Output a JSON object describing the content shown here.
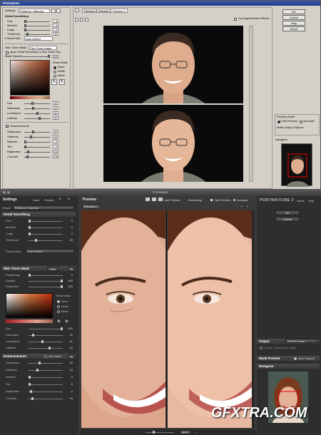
{
  "top": {
    "title": "Portraiture",
    "settings_label": "Settings",
    "settings_value": "Enhance: Glamour",
    "detail_header": "Detail Smoothing",
    "detail_controls": [
      {
        "label": "Fine",
        "value": "0"
      },
      {
        "label": "Medium",
        "value": "0"
      },
      {
        "label": "Large",
        "value": "0"
      },
      {
        "label": "Threshold",
        "value": "10"
      }
    ],
    "portrait_size_label": "Portrait Size",
    "portrait_size_value": "Auto Detect",
    "skin_mask_label": "Skin Tones Mask",
    "skin_mask_value": "Pick From Image",
    "apply_label": "Apply \"Detail Smoothing\" to Skin Tones Only",
    "mask_opacity_label": "Mask Opacity",
    "mask_opacity_value": "100",
    "show_mask_label": "Show Mask",
    "show_mask_options": [
      "None",
      "White",
      "Black"
    ],
    "mask_controls": [
      {
        "label": "Hue",
        "value": "30"
      },
      {
        "label": "Saturation",
        "value": "33"
      },
      {
        "label": "Luminance",
        "value": "50"
      },
      {
        "label": "Latitude",
        "value": "60"
      }
    ],
    "enhancements_label": "Enhancements",
    "enh_controls": [
      {
        "label": "Sharpness",
        "value": "32"
      },
      {
        "label": "Softness",
        "value": "24"
      },
      {
        "label": "Warmth",
        "value": "0"
      },
      {
        "label": "Tint",
        "value": "0"
      },
      {
        "label": "Brightness",
        "value": "+12"
      },
      {
        "label": "Contrast",
        "value": "+10"
      }
    ],
    "tabs": [
      "Preview 1",
      "Preview 2",
      "Preview 3"
    ],
    "top_bottom_label": "Top Original Bottom Filtered",
    "buttons": [
      "OK",
      "Cancel",
      "Help",
      "About"
    ],
    "preview_mode_label": "Preview Mode",
    "fast_preview": "Fast Preview",
    "accurate": "Accurate",
    "mask_output_label": "Mask Output Options",
    "navigator_label": "Navigator"
  },
  "bot": {
    "title": "Portraiture",
    "settings_label": "Settings",
    "save_label": "Save",
    "presets_label": "Presets",
    "preset_label": "Preset",
    "preset_value": "Enhance: Glamour",
    "detail_header": "Detail Smoothing",
    "detail_controls": [
      {
        "label": "Fine",
        "value": "0"
      },
      {
        "label": "Medium",
        "value": "0"
      },
      {
        "label": "Large",
        "value": "0"
      },
      {
        "label": "Threshold",
        "value": "20"
      }
    ],
    "portrait_size_label": "Portrait Size",
    "portrait_size_value": "Auto Detect",
    "skin_header": "Skin Tones Mask",
    "skin_mode": "Auto",
    "skin_controls_top": [
      {
        "label": "Feathering",
        "value": "0"
      },
      {
        "label": "Opacity",
        "value": "100"
      },
      {
        "label": "Fuzziness",
        "value": "100"
      }
    ],
    "show_mask_label": "Show Mask",
    "show_mask_options": [
      "None",
      "White",
      "Black"
    ],
    "skin_controls_bottom": [
      {
        "label": "Hue",
        "value": "100"
      },
      {
        "label": "Saturation",
        "value": "11"
      },
      {
        "label": "Luminance",
        "value": "41"
      },
      {
        "label": "Latitude",
        "value": "62"
      }
    ],
    "enh_header": "Enhancements",
    "use_mask": "Use Mask",
    "enh_controls": [
      {
        "label": "Sharpness",
        "value": "32"
      },
      {
        "label": "Softness",
        "value": "24"
      },
      {
        "label": "Warmth",
        "value": "0"
      },
      {
        "label": "Tint",
        "value": "0"
      },
      {
        "label": "Brightness",
        "value": "-4"
      },
      {
        "label": "Contrast",
        "value": "+8"
      }
    ],
    "preview_label": "Preview",
    "add_preview": "Add Preview",
    "bracketing": "Bracketing",
    "fast_preview": "Fast Preview",
    "accurate": "Accurate",
    "preview_tab": "Preview 1",
    "zoom": "50%",
    "brand": "PORTRAITURE 2",
    "about": "About",
    "help": "Help",
    "ok": "OK",
    "cancel": "Cancel",
    "output_label": "Output",
    "output_value": "Current Layer",
    "create_layer_label": "Create Transparent Mask",
    "mask_preview": "Mask Preview",
    "auto_expand": "Auto Expand",
    "navigator": "Navigator",
    "watermark": "GFXTRA.COM"
  }
}
